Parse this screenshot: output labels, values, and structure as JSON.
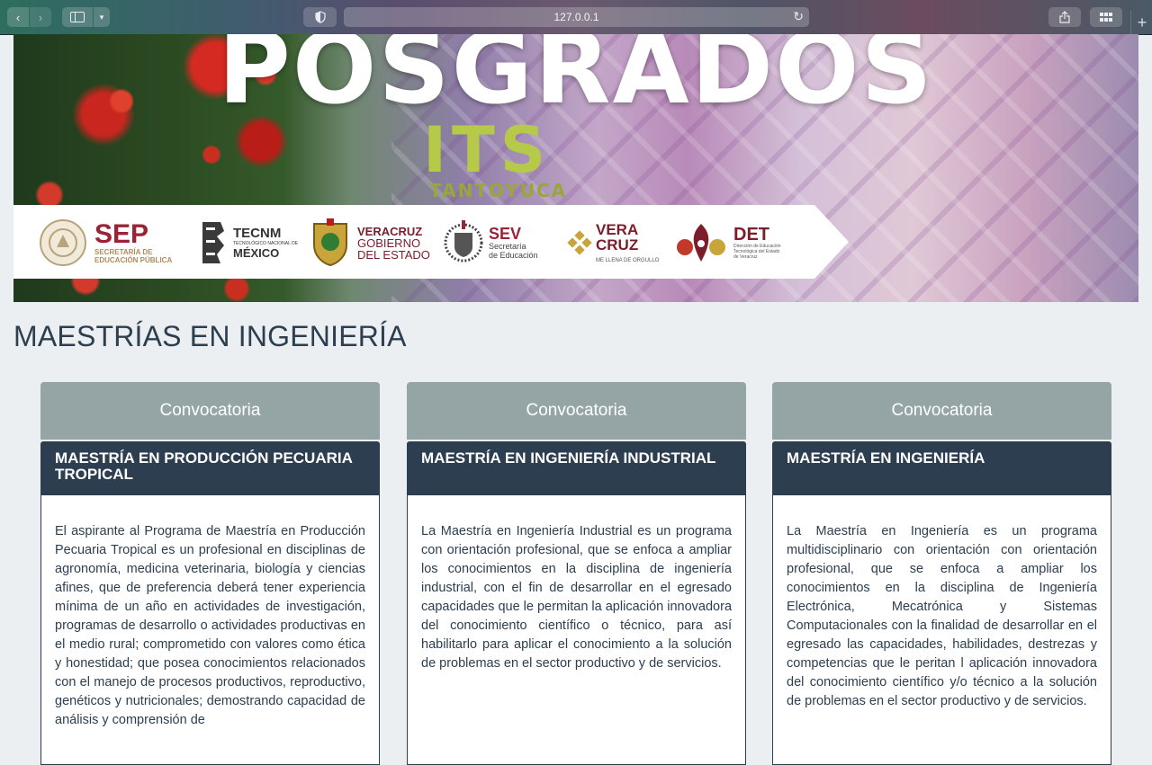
{
  "browser": {
    "url": "127.0.0.1"
  },
  "banner": {
    "title": "POSGRADOS",
    "subtitle": "ITS",
    "caption": "TANTOYUCA",
    "logos": {
      "sep_name": "SEP",
      "sep_line1": "SECRETARÍA DE",
      "sep_line2": "EDUCACIÓN PÚBLICA",
      "tecnm_name": "TECNM",
      "tecnm_line1": "TECNOLÓGICO NACIONAL DE",
      "tecnm_line2": "MÉXICO",
      "veracruz_line1": "VERACRUZ",
      "veracruz_line2": "GOBIERNO",
      "veracruz_line3": "DEL ESTADO",
      "sev_name": "SEV",
      "sev_line1": "Secretaría",
      "sev_line2": "de Educación",
      "vera_line1": "VERA",
      "vera_line2": "CRUZ",
      "vera_tagline": "ME LLENA DE ORGULLO",
      "det_name": "DET",
      "det_line1": "Dirección de Educación",
      "det_line2": "Tecnológica del Estado",
      "det_line3": "de Veracruz"
    }
  },
  "section": {
    "title": "MAESTRÍAS EN INGENIERÍA"
  },
  "cards": [
    {
      "button": "Convocatoria",
      "title": "MAESTRÍA EN PRODUCCIÓN PECUARIA TROPICAL",
      "body": "El aspirante al Programa de Maestría en Producción Pecuaria Tropical es un profesional en disciplinas de agronomía, medicina veterinaria, biología y ciencias afines, que de preferencia deberá tener experiencia mínima de un año en actividades de investigación, programas de desarrollo o actividades productivas en el medio rural; comprometido con valores como ética y honestidad; que posea conocimientos relacionados con el manejo de procesos productivos, reproductivo, genéticos y nutricionales; demostrando capacidad de análisis y comprensión de"
    },
    {
      "button": "Convocatoria",
      "title": "MAESTRÍA EN INGENIERÍA INDUSTRIAL",
      "body": "La Maestría en Ingeniería Industrial es un programa con orientación profesional, que se enfoca a ampliar los conocimientos en la disciplina de ingeniería industrial, con el fin de desarrollar en el egresado capacidades que le permitan la aplicación innovadora del conocimiento científico o técnico, para así habilitarlo para aplicar el conocimiento a la solución de problemas en el sector productivo y de servicios."
    },
    {
      "button": "Convocatoria",
      "title": "MAESTRÍA EN INGENIERÍA",
      "body": "La Maestría en Ingeniería es un programa multidisciplinario con orientación con orientación profesional, que se enfoca a ampliar los conocimientos en la disciplina de Ingeniería Electrónica, Mecatrónica y Sistemas Computacionales con la finalidad de desarrollar en el egresado las capacidades, habilidades, destrezas y competencias que le peritan l aplicación innovadora del conocimiento científico y/o técnico a la solución de problemas en el sector productivo y de servicios."
    }
  ],
  "colors": {
    "heading": "#2c3e50",
    "card_header": "#2c3e50",
    "button": "#95a5a6",
    "background": "#eceff1"
  }
}
